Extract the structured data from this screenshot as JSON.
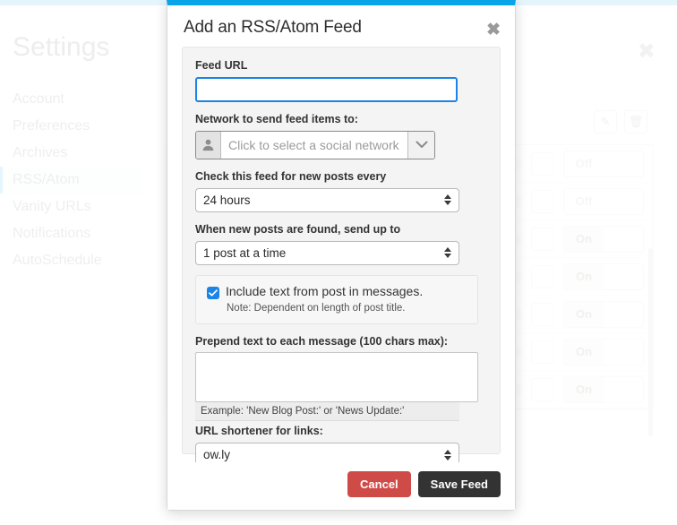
{
  "background": {
    "page_title": "Settings",
    "close_icon": "close-icon",
    "nav_items": [
      {
        "label": "Account",
        "active": false
      },
      {
        "label": "Preferences",
        "active": false
      },
      {
        "label": "Archives",
        "active": false
      },
      {
        "label": "RSS/Atom",
        "active": true
      },
      {
        "label": "Vanity URLs",
        "active": false
      },
      {
        "label": "Notifications",
        "active": false
      },
      {
        "label": "AutoSchedule",
        "active": false
      }
    ],
    "toolbar_icons": [
      "edit-pencil-icon",
      "trash-icon"
    ],
    "feed_rows": [
      {
        "toggle": "Off",
        "state": "off"
      },
      {
        "toggle": "Off",
        "state": "off"
      },
      {
        "toggle": "On",
        "state": "on"
      },
      {
        "toggle": "On",
        "state": "on"
      },
      {
        "toggle": "On",
        "state": "on"
      },
      {
        "toggle": "On",
        "state": "on"
      },
      {
        "toggle": "On",
        "state": "on"
      }
    ],
    "accent_color": "#0aa5e8"
  },
  "modal": {
    "title": "Add an RSS/Atom Feed",
    "close_label": "✖",
    "accent_color": "#0aa5e8",
    "fields": {
      "feed_url": {
        "label": "Feed URL",
        "value": "",
        "placeholder": ""
      },
      "network": {
        "label": "Network to send feed items to:",
        "placeholder": "Click to select a social network",
        "avatar_icon": "user-avatar-icon",
        "caret_icon": "chevron-down-icon"
      },
      "check_interval": {
        "label": "Check this feed for new posts every",
        "value": "24 hours"
      },
      "posts_batch": {
        "label": "When new posts are found, send up to",
        "value": "1 post at a time"
      },
      "include_text": {
        "label": "Include text from post in messages.",
        "note": "Note: Dependent on length of post title.",
        "checked": true
      },
      "prepend": {
        "label": "Prepend text to each message (100 chars max):",
        "value": "",
        "example": "Example: 'New Blog Post:' or 'News Update:'"
      },
      "shortener": {
        "label": "URL shortener for links:",
        "value": "ow.ly"
      }
    },
    "footer": {
      "cancel_label": "Cancel",
      "save_label": "Save Feed"
    }
  }
}
